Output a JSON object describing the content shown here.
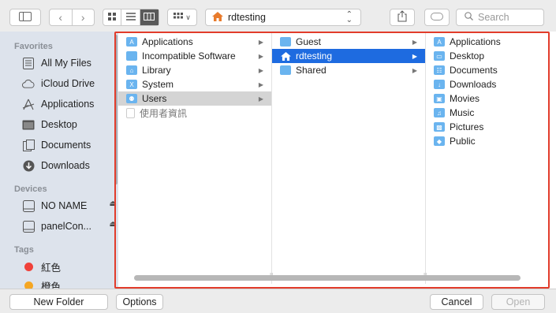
{
  "toolbar": {
    "path_label": "rdtesting",
    "search_placeholder": "Search"
  },
  "sidebar": {
    "favorites_header": "Favorites",
    "favorites": [
      {
        "label": "All My Files",
        "icon": "all-files-icon"
      },
      {
        "label": "iCloud Drive",
        "icon": "cloud-icon"
      },
      {
        "label": "Applications",
        "icon": "applications-icon"
      },
      {
        "label": "Desktop",
        "icon": "desktop-icon"
      },
      {
        "label": "Documents",
        "icon": "documents-icon"
      },
      {
        "label": "Downloads",
        "icon": "downloads-icon"
      }
    ],
    "devices_header": "Devices",
    "devices": [
      {
        "label": "NO NAME",
        "icon": "drive-icon"
      },
      {
        "label": "panelCon...",
        "icon": "drive-icon"
      }
    ],
    "tags_header": "Tags",
    "tags": [
      {
        "label": "紅色",
        "color": "#f0413a"
      },
      {
        "label": "橙色",
        "color": "#f5a623"
      }
    ]
  },
  "browser": {
    "col1": [
      {
        "label": "Applications",
        "icon": "applications-folder-icon"
      },
      {
        "label": "Incompatible Software",
        "icon": "folder-icon"
      },
      {
        "label": "Library",
        "icon": "library-folder-icon"
      },
      {
        "label": "System",
        "icon": "system-folder-icon"
      },
      {
        "label": "Users",
        "icon": "users-folder-icon",
        "selected": "gray"
      },
      {
        "label": "使用者資訊",
        "icon": "document-icon"
      }
    ],
    "col2": [
      {
        "label": "Guest",
        "icon": "folder-icon"
      },
      {
        "label": "rdtesting",
        "icon": "home-icon",
        "selected": "blue"
      },
      {
        "label": "Shared",
        "icon": "folder-icon"
      }
    ],
    "col3": [
      {
        "label": "Applications",
        "icon": "applications-folder-icon"
      },
      {
        "label": "Desktop",
        "icon": "desktop-folder-icon"
      },
      {
        "label": "Documents",
        "icon": "documents-folder-icon"
      },
      {
        "label": "Downloads",
        "icon": "downloads-folder-icon"
      },
      {
        "label": "Movies",
        "icon": "movies-folder-icon"
      },
      {
        "label": "Music",
        "icon": "music-folder-icon"
      },
      {
        "label": "Pictures",
        "icon": "pictures-folder-icon"
      },
      {
        "label": "Public",
        "icon": "public-folder-icon"
      }
    ]
  },
  "bottom": {
    "new_folder": "New Folder",
    "options": "Options",
    "cancel": "Cancel",
    "open": "Open"
  },
  "colors": {
    "selection_blue": "#1e6be0",
    "highlight_border": "#e23c2b",
    "sidebar_bg": "#dde3ec"
  }
}
